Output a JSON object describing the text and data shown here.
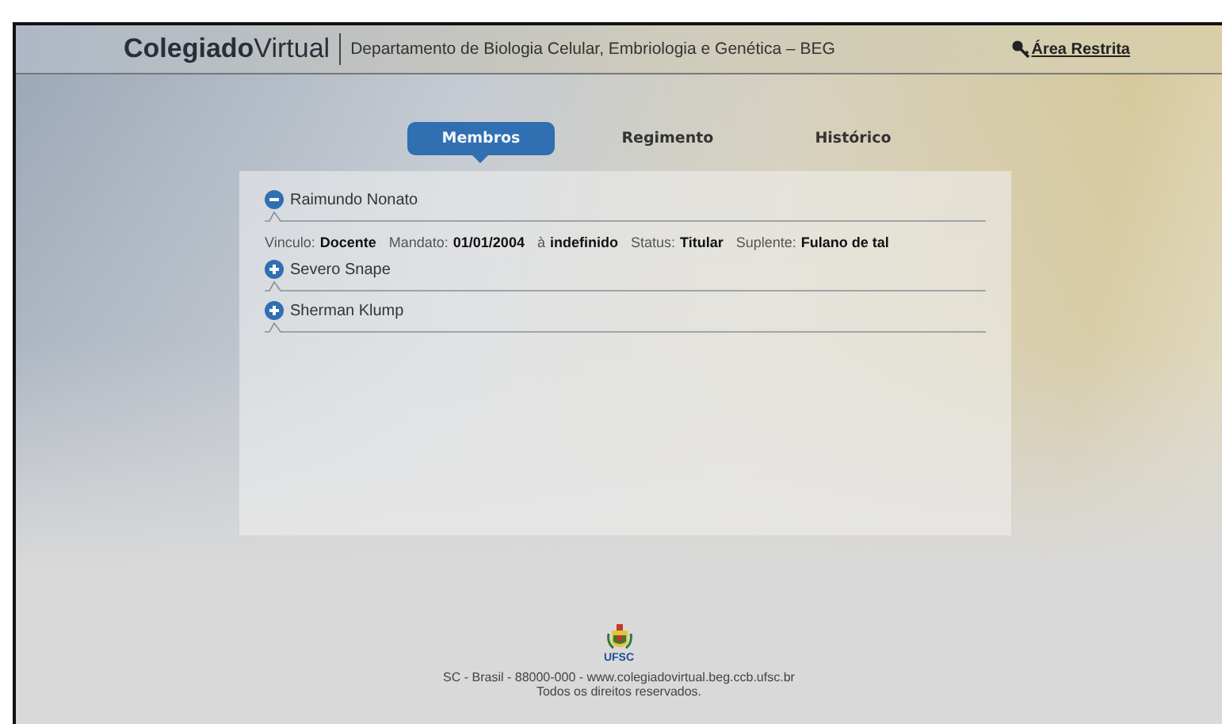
{
  "header": {
    "brand_bold": "Colegiado",
    "brand_light": "Virtual",
    "department": "Departamento de Biologia Celular, Embriologia e Genética – BEG",
    "restricted_link": "Área Restrita"
  },
  "tabs": [
    {
      "label": "Membros",
      "selected": true
    },
    {
      "label": "Regimento",
      "selected": false
    },
    {
      "label": "Histórico",
      "selected": false
    }
  ],
  "members": [
    {
      "name": "Raimundo Nonato",
      "expanded": true,
      "details": [
        {
          "label": "Vinculo:",
          "value": "Docente"
        },
        {
          "label": "Mandato:",
          "value": "01/01/2004"
        },
        {
          "label": "à",
          "value": "indefinido"
        },
        {
          "label": "Status:",
          "value": "Titular"
        },
        {
          "label": "Suplente:",
          "value": "Fulano de tal"
        }
      ]
    },
    {
      "name": "Severo Snape",
      "expanded": false
    },
    {
      "name": "Sherman Klump",
      "expanded": false
    }
  ],
  "footer": {
    "logo_text": "UFSC",
    "address": "SC - Brasil - 88000-000 - www.colegiadovirtual.beg.ccb.ufsc.br",
    "rights": "Todos os direitos reservados."
  }
}
